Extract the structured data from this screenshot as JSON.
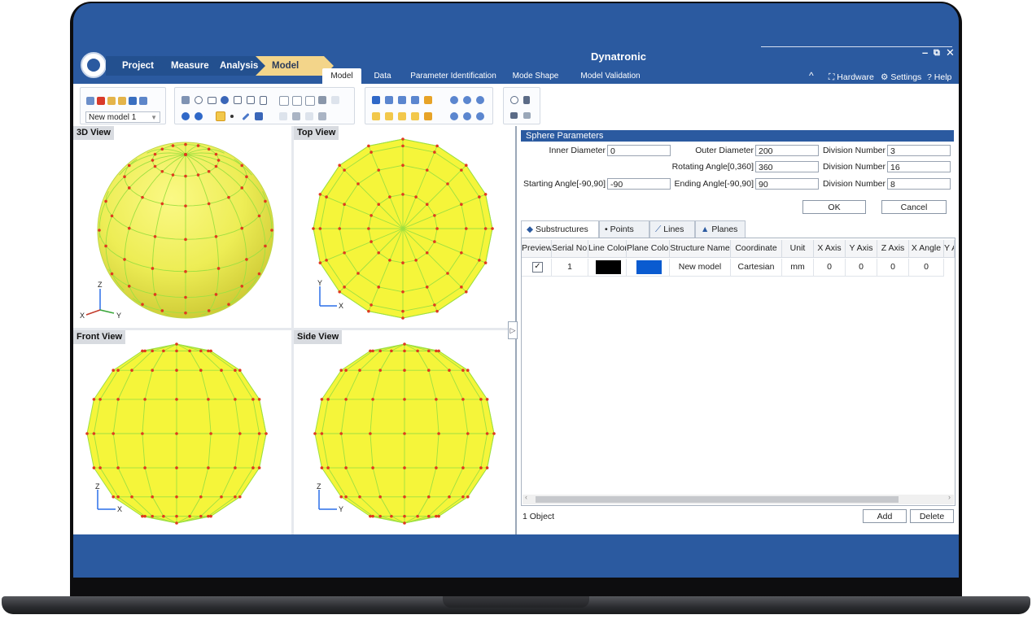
{
  "app": {
    "title": "Dynatronic"
  },
  "breadcrumbs": [
    "Project",
    "Measure",
    "Analysis",
    "Model"
  ],
  "window_controls": {
    "minimize": "–",
    "restore": "⧉",
    "close": "✕"
  },
  "menu_tabs": [
    {
      "label": "Model",
      "active": true
    },
    {
      "label": "Data",
      "active": false
    },
    {
      "label": "Parameter Identification",
      "active": false
    },
    {
      "label": "Mode Shape",
      "active": false
    },
    {
      "label": "Model Validation",
      "active": false
    }
  ],
  "right_links": {
    "collapse": "^",
    "hardware": "Hardware",
    "settings": "Settings",
    "help": "Help"
  },
  "ribbon": {
    "model_select": "New model 1"
  },
  "views": {
    "view3d": {
      "label": "3D View",
      "axes": [
        "Z",
        "X",
        "Y"
      ]
    },
    "top": {
      "label": "Top View",
      "axes": [
        "Y",
        "X"
      ]
    },
    "front": {
      "label": "Front View",
      "axes": [
        "Z",
        "X"
      ]
    },
    "side": {
      "label": "Side View",
      "axes": [
        "Z",
        "Y"
      ]
    }
  },
  "panel": {
    "title": "Sphere Parameters",
    "inner_diameter_label": "Inner Diameter",
    "inner_diameter": "0",
    "outer_diameter_label": "Outer Diameter",
    "outer_diameter": "200",
    "division_label": "Division Number",
    "division_1": "3",
    "rotating_angle_label": "Rotating Angle[0,360]",
    "rotating_angle": "360",
    "division_2": "16",
    "start_angle_label": "Starting Angle[-90,90]",
    "start_angle": "-90",
    "end_angle_label": "Ending Angle[-90,90]",
    "end_angle": "90",
    "division_3": "8",
    "ok": "OK",
    "cancel": "Cancel"
  },
  "sub_tabs": [
    {
      "label": "Substructures",
      "active": true
    },
    {
      "label": "Points",
      "active": false
    },
    {
      "label": "Lines",
      "active": false
    },
    {
      "label": "Planes",
      "active": false
    }
  ],
  "table": {
    "headers": [
      "Preview",
      "Serial No.",
      "Line Color",
      "Plane Color",
      "Structure Name",
      "Coordinate",
      "Unit",
      "X Axis",
      "Y Axis",
      "Z Axis",
      "X Angle",
      "Y A"
    ],
    "row": {
      "preview": "✓",
      "serial": "1",
      "line_color": "#000000",
      "plane_color": "#0a5bd0",
      "name": "New model",
      "coordinate": "Cartesian",
      "unit": "mm",
      "x": "0",
      "y": "0",
      "z": "0",
      "x_angle": "0"
    }
  },
  "status": {
    "count": "1 Object",
    "add": "Add",
    "delete": "Delete"
  },
  "colors": {
    "accent": "#2b5aa0",
    "sphere_fill": "#f5f53a",
    "sphere_edge": "#9ee040",
    "node": "#e03a1f"
  }
}
